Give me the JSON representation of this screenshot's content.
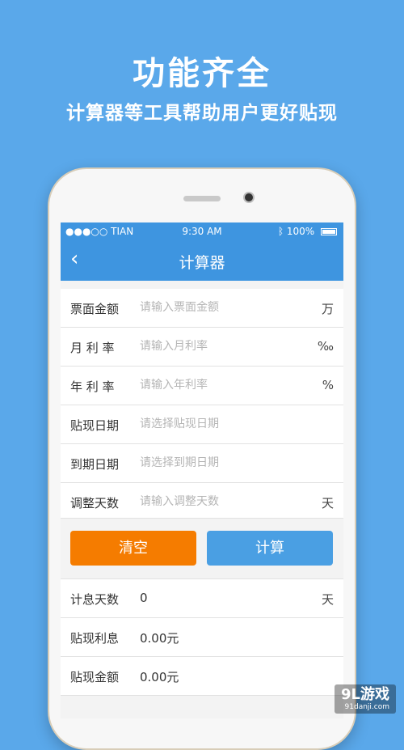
{
  "promo": {
    "title": "功能齐全",
    "subtitle": "计算器等工具帮助用户更好贴现"
  },
  "status_bar": {
    "carrier": "●●●○○ TIAN",
    "time": "9:30 AM",
    "battery": "100%"
  },
  "nav": {
    "back_icon": "‹",
    "title": "计算器"
  },
  "form": {
    "rows": [
      {
        "label": "票面金额",
        "placeholder": "请输入票面金额",
        "unit": "万"
      },
      {
        "label": "月 利 率",
        "placeholder": "请输入月利率",
        "unit": "‰"
      },
      {
        "label": "年 利 率",
        "placeholder": "请输入年利率",
        "unit": "%"
      },
      {
        "label": "贴现日期",
        "placeholder": "请选择贴现日期",
        "unit": ""
      },
      {
        "label": "到期日期",
        "placeholder": "请选择到期日期",
        "unit": ""
      },
      {
        "label": "调整天数",
        "placeholder": "请输入调整天数",
        "unit": "天"
      }
    ]
  },
  "buttons": {
    "clear": "清空",
    "calculate": "计算"
  },
  "results": {
    "rows": [
      {
        "label": "计息天数",
        "value": "0",
        "unit": "天"
      },
      {
        "label": "贴现利息",
        "value": "0.00元",
        "unit": ""
      },
      {
        "label": "贴现金额",
        "value": "0.00元",
        "unit": ""
      }
    ]
  },
  "watermark": {
    "brand": "9L游戏",
    "url": "91danji.com"
  },
  "colors": {
    "background": "#5aa8ea",
    "navbar": "#3e95e0",
    "clear_button": "#f57c00",
    "calc_button": "#4a9fe3"
  }
}
